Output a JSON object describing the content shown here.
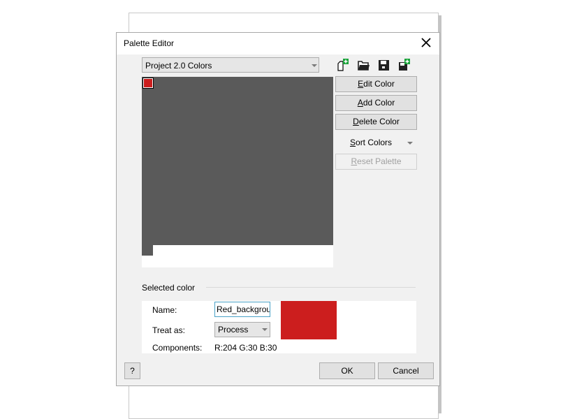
{
  "dialog": {
    "title": "Palette Editor",
    "close_icon": "close-icon"
  },
  "palette_select": {
    "value": "Project 2.0 Colors"
  },
  "toolbar_icons": [
    "new-palette-icon",
    "open-palette-icon",
    "save-palette-icon",
    "save-as-palette-icon"
  ],
  "palette": {
    "swatches": [
      {
        "name": "Red_background",
        "color": "#cc1e1e",
        "selected": true
      }
    ]
  },
  "buttons": {
    "edit_color": {
      "mnemonic": "E",
      "rest": "dit Color"
    },
    "add_color": {
      "mnemonic": "A",
      "rest": "dd Color"
    },
    "delete_color": {
      "mnemonic": "D",
      "rest": "elete Color"
    },
    "sort_colors": {
      "mnemonic": "S",
      "rest": "ort Colors"
    },
    "reset_palette": {
      "mnemonic": "R",
      "rest": "eset Palette"
    },
    "help": "?",
    "ok": "OK",
    "cancel": "Cancel"
  },
  "selected_color": {
    "section_label": "Selected color",
    "name_label": "Name:",
    "name_value": "Red_backgrou",
    "treat_label": "Treat as:",
    "treat_value": "Process",
    "components_label": "Components:",
    "components_value": "R:204 G:30 B:30",
    "color": "#cc1e1e"
  }
}
